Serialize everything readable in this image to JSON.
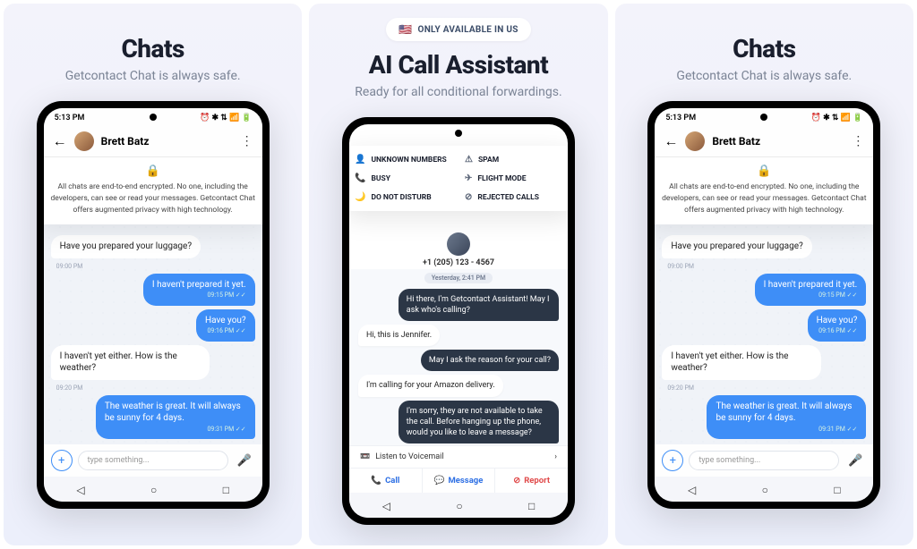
{
  "panel_chats": {
    "title": "Chats",
    "subtitle": "Getcontact Chat is always safe.",
    "status_time": "5:13 PM",
    "contact_name": "Brett Batz",
    "encrypt_text": "All chats are end-to-end encrypted. No one, including the developers, can see or read your messages. Getcontact Chat offers augmented privacy with high technology.",
    "messages": [
      {
        "dir": "in",
        "text": "Have you prepared your luggage?",
        "ts": "09:00 PM"
      },
      {
        "dir": "out",
        "text": "I haven't prepared it yet.",
        "ts": "09:15 PM ✓✓"
      },
      {
        "dir": "out",
        "text": "Have you?",
        "ts": "09:16 PM ✓✓"
      },
      {
        "dir": "in",
        "text": "I haven't yet either. How is the weather?",
        "ts": "09:20 PM"
      },
      {
        "dir": "out",
        "text": "The weather is great. It will always be sunny for 4 days.",
        "ts": "09:31 PM ✓✓"
      }
    ],
    "input_placeholder": "type something..."
  },
  "panel_assistant": {
    "badge": "ONLY AVAILABLE IN US",
    "title": "AI Call Assistant",
    "subtitle": "Ready for all conditional forwardings.",
    "forward_options": [
      "UNKNOWN NUMBERS",
      "SPAM",
      "BUSY",
      "FLIGHT MODE",
      "DO NOT DISTURB",
      "REJECTED CALLS"
    ],
    "forward_icons": [
      "👤",
      "⚠",
      "📞",
      "✈",
      "🌙",
      "⊘"
    ],
    "caller_number": "+1 (205) 123 - 4567",
    "date_label": "Yesterday, 2:41 PM",
    "conversation": [
      {
        "side": "dark",
        "text": "Hi there, I'm Getcontact Assistant! May I ask who's calling?"
      },
      {
        "side": "light",
        "text": "Hi, this is Jennifer."
      },
      {
        "side": "dark",
        "text": "May I ask the reason for your call?"
      },
      {
        "side": "light",
        "text": "I'm calling for your Amazon delivery."
      },
      {
        "side": "dark",
        "text": "I'm sorry, they are not available to take the call. Before hanging up the phone, would you like to leave a message?"
      }
    ],
    "voicemail_label": "Listen to Voicemail",
    "actions": {
      "call": "Call",
      "message": "Message",
      "report": "Report"
    }
  }
}
